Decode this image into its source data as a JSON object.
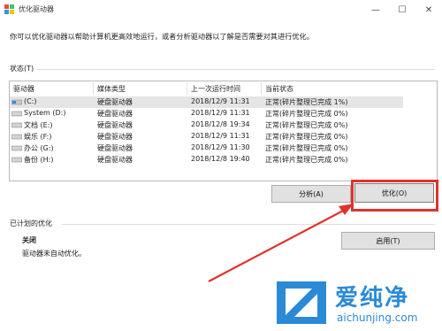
{
  "window": {
    "title": "优化驱动器",
    "minimize_glyph": "—",
    "maximize_glyph": "☐",
    "close_glyph": "✕"
  },
  "intro_text": "你可以优化驱动器以帮助计算机更高效地运行，或者分析驱动器以了解是否需要对其进行优化。",
  "status": {
    "section_label": "状态(T)",
    "columns": [
      "驱动器",
      "媒体类型",
      "上一次运行时间",
      "当前状态"
    ],
    "rows": [
      {
        "drive": "(C:)",
        "media": "硬盘驱动器",
        "last_run": "2018/12/9 11:31",
        "status": "正常(碎片整理已完成 1%)"
      },
      {
        "drive": "System (D:)",
        "media": "硬盘驱动器",
        "last_run": "2018/12/9 11:31",
        "status": "正常(碎片整理已完成 0%)"
      },
      {
        "drive": "文档 (E:)",
        "media": "硬盘驱动器",
        "last_run": "2018/12/8 19:34",
        "status": "正常(碎片整理已完成 0%)"
      },
      {
        "drive": "娱乐 (F:)",
        "media": "硬盘驱动器",
        "last_run": "2018/12/9 11:31",
        "status": "正常(碎片整理已完成 0%)"
      },
      {
        "drive": "办公 (G:)",
        "media": "硬盘驱动器",
        "last_run": "2018/12/9 11:30",
        "status": "正常(碎片整理已完成 0%)"
      },
      {
        "drive": "备份 (H:)",
        "media": "硬盘驱动器",
        "last_run": "2018/12/8 19:40",
        "status": "正常(碎片整理已完成 0%)"
      }
    ]
  },
  "actions": {
    "analyze_label": "分析(A)",
    "optimize_label": "优化(O)"
  },
  "scheduled": {
    "section_label": "已计划的优化",
    "state": "关闭",
    "description": "驱动器未自动优化。",
    "enable_label": "启用(T)"
  },
  "watermark": {
    "brand": "爱纯净",
    "url": "aichunjing.com"
  },
  "colors": {
    "annotation_red": "#e0322c",
    "selection_gray": "#e5e5e5",
    "logo_blue": "#2b8ad6"
  }
}
